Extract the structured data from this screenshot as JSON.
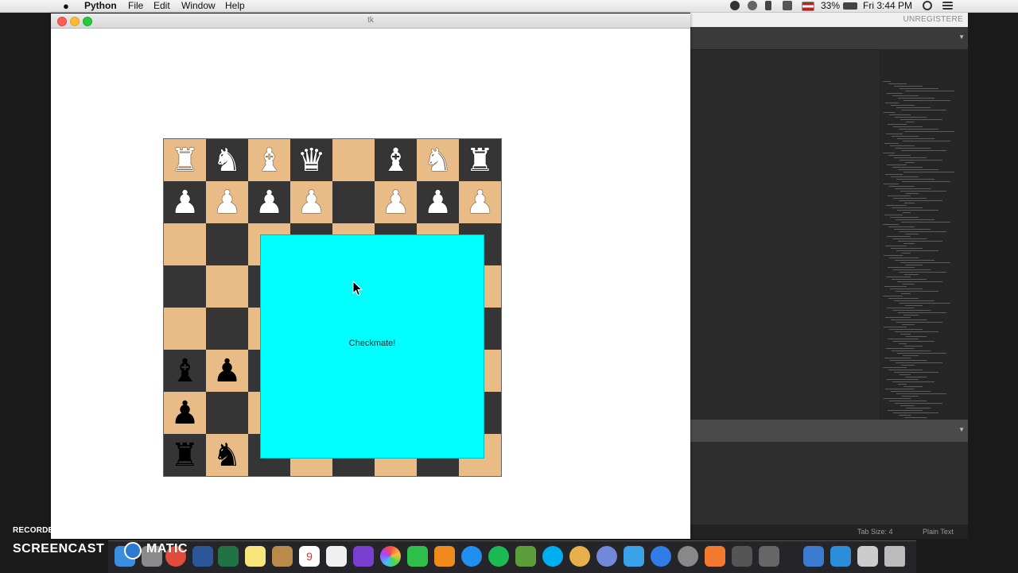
{
  "menubar": {
    "apple": "",
    "app": "Python",
    "items": [
      "File",
      "Edit",
      "Window",
      "Help"
    ],
    "battery": "33%",
    "clock": "Fri 3:44 PM"
  },
  "tk_window": {
    "title": "tk"
  },
  "board": {
    "rows": [
      [
        "♜",
        "♞",
        "♝",
        "♛",
        "",
        "♝",
        "♞",
        "♜"
      ],
      [
        "♟",
        "♟",
        "♟",
        "♟",
        "",
        "♟",
        "♟",
        "♟"
      ],
      [
        "",
        "",
        "",
        "",
        "",
        "",
        "",
        ""
      ],
      [
        "",
        "",
        "",
        "",
        "",
        "",
        "",
        ""
      ],
      [
        "",
        "",
        "",
        "",
        "",
        "",
        "",
        ""
      ],
      [
        "♝",
        "♟",
        "",
        "",
        "",
        "",
        "",
        ""
      ],
      [
        "♟",
        "",
        "",
        "",
        "",
        "",
        "",
        ""
      ],
      [
        "♜",
        "♞",
        "",
        "",
        "",
        "",
        "",
        ""
      ]
    ],
    "piece_colors": [
      [
        "w",
        "w",
        "w",
        "w",
        "",
        "w",
        "w",
        "w"
      ],
      [
        "w",
        "w",
        "w",
        "w",
        "",
        "w",
        "w",
        "w"
      ],
      [
        "",
        "",
        "",
        "",
        "",
        "",
        "",
        ""
      ],
      [
        "",
        "",
        "",
        "",
        "",
        "",
        "",
        ""
      ],
      [
        "",
        "",
        "",
        "",
        "",
        "",
        "",
        ""
      ],
      [
        "b",
        "b",
        "",
        "",
        "",
        "",
        "",
        ""
      ],
      [
        "b",
        "",
        "",
        "",
        "",
        "",
        "",
        ""
      ],
      [
        "b",
        "b",
        "",
        "",
        "",
        "",
        "",
        ""
      ]
    ],
    "light_color": "#e8bb87",
    "dark_color": "#353535"
  },
  "popup": {
    "message": "Checkmate!",
    "color": "#00ffff"
  },
  "editor": {
    "unregistered": "UNREGISTERE",
    "tab_size": "Tab Size: 4",
    "syntax": "Plain Text"
  },
  "watermark": {
    "recorded": "RECORDED WITH",
    "brand": "SCREENCAST",
    "brand_suffix": "MATIC"
  },
  "dock": {
    "calendar_day": "9"
  }
}
